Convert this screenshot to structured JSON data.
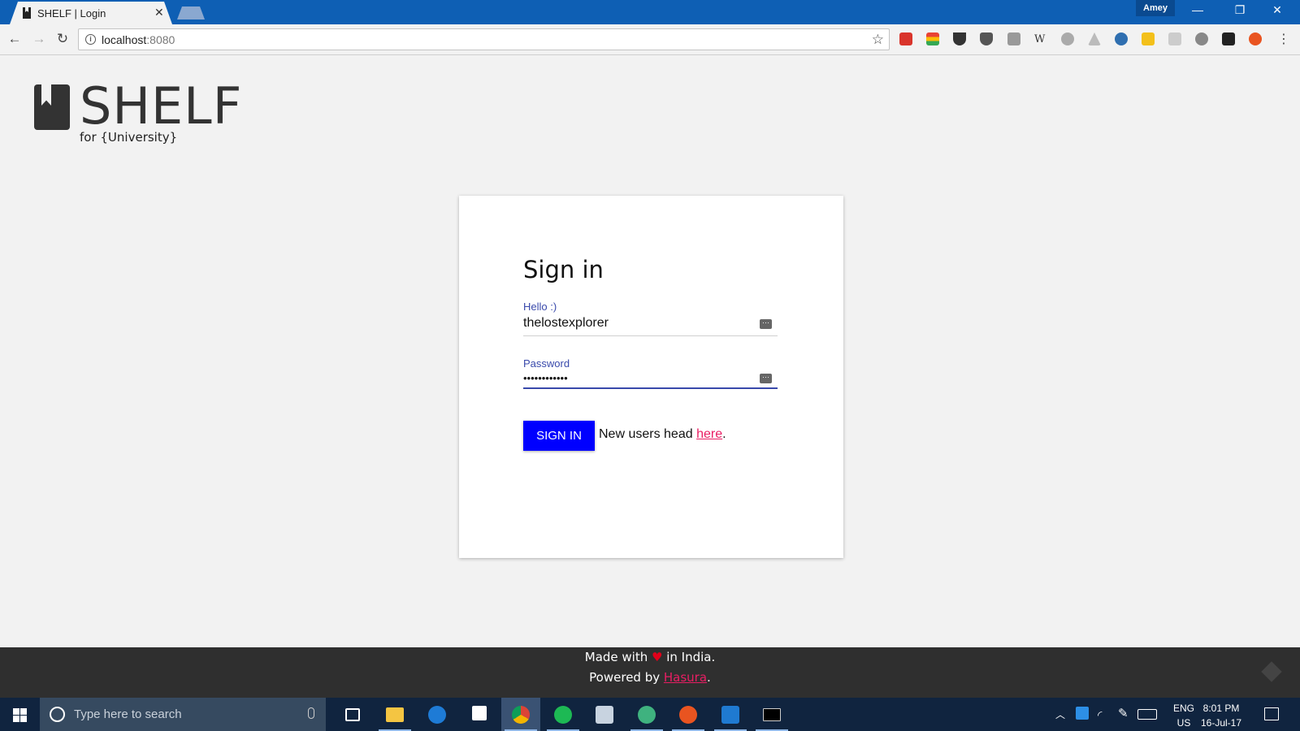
{
  "browser": {
    "tab_title": "SHELF | Login",
    "profile_name": "Amey",
    "url_host": "localhost",
    "url_port": ":8080"
  },
  "logo": {
    "title": "SHELF",
    "subtitle": "for {University}"
  },
  "signin": {
    "heading": "Sign in",
    "username_label": "Hello :)",
    "username_value": "thelostexplorer",
    "password_label": "Password",
    "password_value": "••••••••••••",
    "button_label": "SIGN IN",
    "newusers_prefix": "New users head ",
    "newusers_link": "here",
    "newusers_suffix": "."
  },
  "footer": {
    "made_prefix": "Made with ",
    "made_suffix": " in India.",
    "powered_prefix": "Powered by ",
    "powered_link": "Hasura",
    "powered_suffix": "."
  },
  "taskbar": {
    "search_placeholder": "Type here to search",
    "lang_line1": "ENG",
    "lang_line2": "US",
    "time": "8:01 PM",
    "date": "16-Jul-17"
  },
  "colors": {
    "titlebar": "#0e5fb4",
    "button": "#0000ff",
    "link": "#e91e63",
    "label": "#3949ab",
    "footer": "#2f2f2f",
    "taskbar": "#10243f"
  },
  "icons": [
    "book-icon",
    "heart-icon",
    "keyboard-icon",
    "star-icon",
    "info-icon",
    "windows-start-icon"
  ]
}
